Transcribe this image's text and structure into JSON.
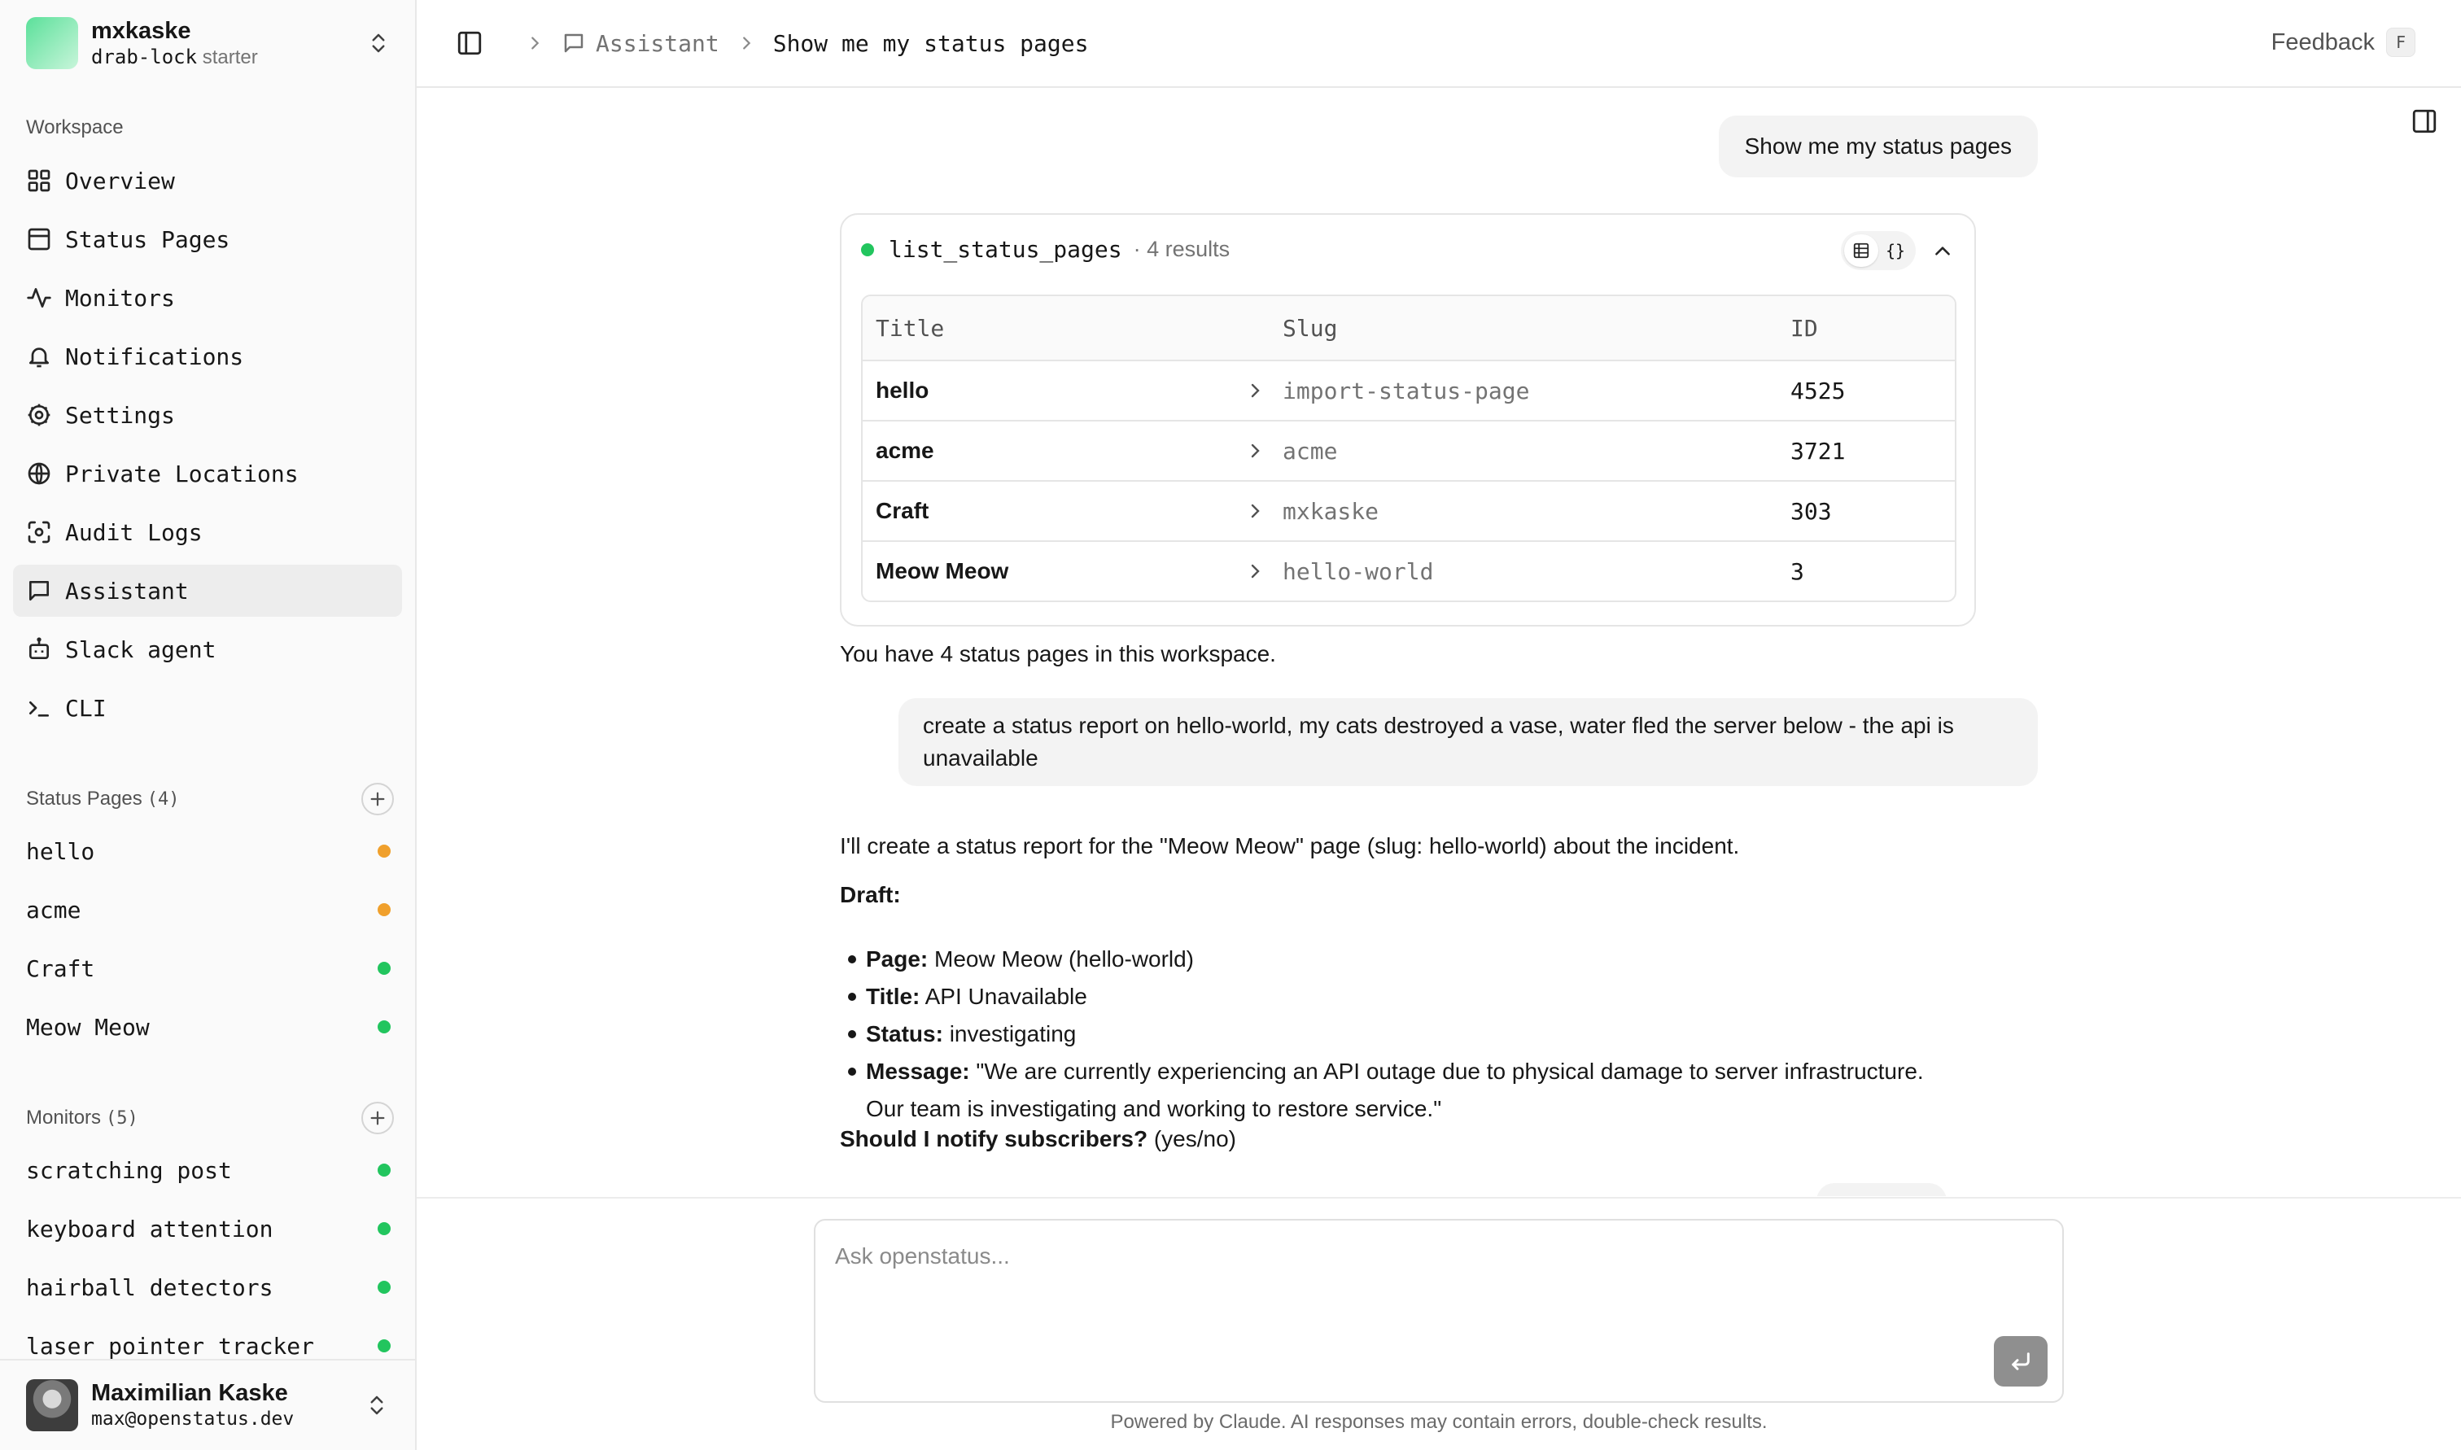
{
  "workspace": {
    "name": "mxkaske",
    "slug": "drab-lock",
    "plan": "starter"
  },
  "sidebar": {
    "section_label": "Workspace",
    "nav": [
      {
        "label": "Overview",
        "icon": "grid-icon"
      },
      {
        "label": "Status Pages",
        "icon": "panel-icon"
      },
      {
        "label": "Monitors",
        "icon": "activity-icon"
      },
      {
        "label": "Notifications",
        "icon": "bell-icon"
      },
      {
        "label": "Settings",
        "icon": "gear-icon"
      },
      {
        "label": "Private Locations",
        "icon": "globe-icon"
      },
      {
        "label": "Audit Logs",
        "icon": "scan-icon"
      },
      {
        "label": "Assistant",
        "icon": "chat-icon",
        "active": true
      },
      {
        "label": "Slack agent",
        "icon": "bot-icon"
      },
      {
        "label": "CLI",
        "icon": "terminal-icon"
      }
    ],
    "status_pages": {
      "title": "Status Pages",
      "count": "(4)",
      "items": [
        {
          "label": "hello",
          "status_color": "#f0a02c"
        },
        {
          "label": "acme",
          "status_color": "#f0a02c"
        },
        {
          "label": "Craft",
          "status_color": "#22c55e"
        },
        {
          "label": "Meow Meow",
          "status_color": "#22c55e"
        }
      ]
    },
    "monitors": {
      "title": "Monitors",
      "count": "(5)",
      "items": [
        {
          "label": "scratching post",
          "status_color": "#22c55e"
        },
        {
          "label": "keyboard attention",
          "status_color": "#22c55e"
        },
        {
          "label": "hairball detectors",
          "status_color": "#22c55e"
        },
        {
          "label": "laser pointer tracker",
          "status_color": "#22c55e"
        }
      ]
    },
    "user": {
      "name": "Maximilian Kaske",
      "email": "max@openstatus.dev"
    }
  },
  "header": {
    "breadcrumb_parent": "Assistant",
    "breadcrumb_current": "Show me my status pages",
    "feedback_label": "Feedback",
    "feedback_shortcut": "F"
  },
  "chat": {
    "user_msg_1": "Show me my status pages",
    "tool": {
      "name": "list_status_pages",
      "result_count": "· 4 results",
      "view_json_label": "{}",
      "columns": [
        "Title",
        "Slug",
        "ID"
      ],
      "rows": [
        {
          "title": "hello",
          "slug": "import-status-page",
          "id": "4525"
        },
        {
          "title": "acme",
          "slug": "acme",
          "id": "3721"
        },
        {
          "title": "Craft",
          "slug": "mxkaske",
          "id": "303"
        },
        {
          "title": "Meow Meow",
          "slug": "hello-world",
          "id": "3"
        }
      ]
    },
    "assistant_msg_1": "You have 4 status pages in this workspace.",
    "user_msg_2": "create a status report on hello-world, my cats destroyed a vase, water fled the server below - the api is unavailable",
    "assistant_msg_2": "I'll create a status report for the \"Meow Meow\" page (slug: hello-world) about the incident.",
    "draft_label": "Draft:",
    "draft": [
      {
        "key": "Page:",
        "value": "Meow Meow (hello-world)"
      },
      {
        "key": "Title:",
        "value": "API Unavailable"
      },
      {
        "key": "Status:",
        "value": "investigating"
      },
      {
        "key": "Message:",
        "value": "\"We are currently experiencing an API outage due to physical damage to server infrastructure."
      },
      {
        "key": "",
        "value": "Our team is investigating and working to restore service.\""
      }
    ],
    "question_bold": "Should I notify subscribers?",
    "question_rest": " (yes/no)"
  },
  "composer": {
    "placeholder": "Ask openstatus...",
    "footer": "Powered by Claude. AI responses may contain errors, double-check results."
  },
  "colors": {
    "accent_green": "#22c55e",
    "warning_orange": "#f0a02c"
  }
}
